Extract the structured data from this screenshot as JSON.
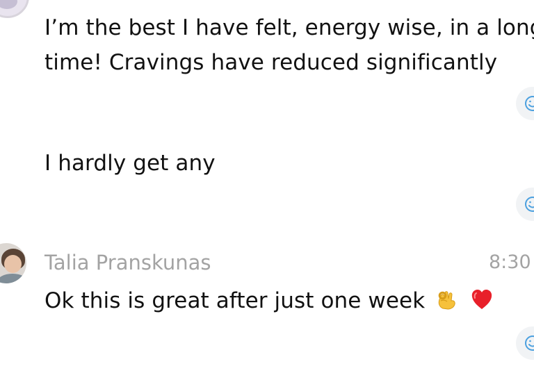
{
  "messages": [
    {
      "lines": [
        "I’m the best I have felt, energy wise, in a long",
        "time! Cravings have reduced significantly"
      ]
    },
    {
      "text": "I hardly get any"
    },
    {
      "sender": "Talia Pranskunas",
      "time": "8:30",
      "text": "Ok this is great after just one week",
      "emojis": [
        "ok-hand-icon",
        "red-heart-icon"
      ]
    }
  ],
  "colors": {
    "text": "#111111",
    "meta": "#a3a3a3",
    "reaction_bg": "#f1f3f5",
    "reaction_icon": "#4ba0df"
  }
}
